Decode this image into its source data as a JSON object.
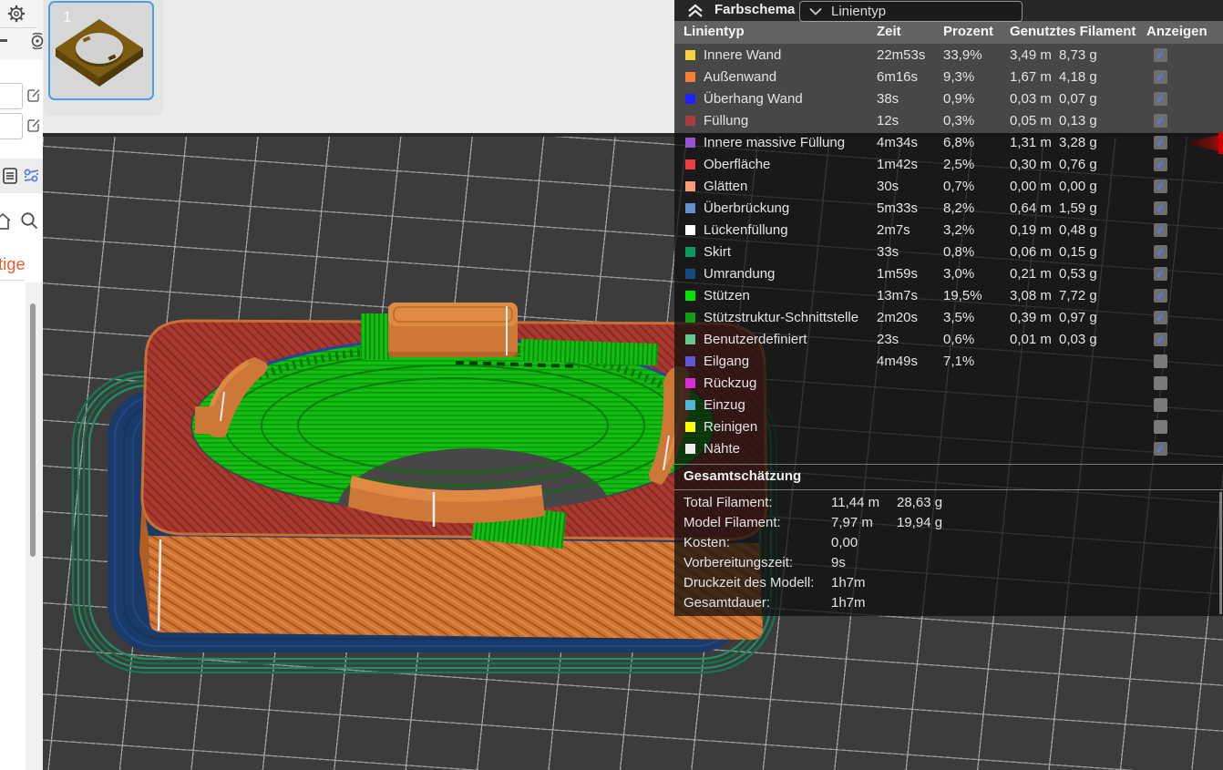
{
  "sidebar": {
    "icons": [
      "gear-icon",
      "minus-icon",
      "filament-spool-icon",
      "edit-icon",
      "edit-icon",
      "document-list-icon",
      "process-params-icon",
      "home-icon",
      "search-icon"
    ],
    "truncated_link_text": "tige"
  },
  "plates": {
    "selected_plate_number": "1"
  },
  "panel": {
    "title": "Farbschema",
    "view_dropdown": {
      "value": "Linientyp"
    },
    "table": {
      "columns": [
        "Linientyp",
        "Zeit",
        "Prozent",
        "Genutztes Filament",
        "Anzeigen"
      ],
      "rows": [
        {
          "color": "#F5D33C",
          "label": "Innere Wand",
          "time": "22m53s",
          "percent": "33,9%",
          "length": "3,49 m",
          "weight": "8,73 g",
          "visible": true
        },
        {
          "color": "#F77E35",
          "label": "Außenwand",
          "time": "6m16s",
          "percent": "9,3%",
          "length": "1,67 m",
          "weight": "4,18 g",
          "visible": true
        },
        {
          "color": "#2121FF",
          "label": "Überhang Wand",
          "time": "38s",
          "percent": "0,9%",
          "length": "0,03 m",
          "weight": "0,07 g",
          "visible": true
        },
        {
          "color": "#A93C3C",
          "label": "Füllung",
          "time": "12s",
          "percent": "0,3%",
          "length": "0,05 m",
          "weight": "0,13 g",
          "visible": true
        },
        {
          "color": "#9355D4",
          "label": "Innere massive Füllung",
          "time": "4m34s",
          "percent": "6,8%",
          "length": "1,31 m",
          "weight": "3,28 g",
          "visible": true
        },
        {
          "color": "#EB4040",
          "label": "Oberfläche",
          "time": "1m42s",
          "percent": "2,5%",
          "length": "0,30 m",
          "weight": "0,76 g",
          "visible": true
        },
        {
          "color": "#F89B77",
          "label": "Glätten",
          "time": "30s",
          "percent": "0,7%",
          "length": "0,00 m",
          "weight": "0,00 g",
          "visible": true
        },
        {
          "color": "#6190CE",
          "label": "Überbrückung",
          "time": "5m33s",
          "percent": "8,2%",
          "length": "0,64 m",
          "weight": "1,59 g",
          "visible": true
        },
        {
          "color": "#FFFFFF",
          "label": "Lückenfüllung",
          "time": "2m7s",
          "percent": "3,2%",
          "length": "0,19 m",
          "weight": "0,48 g",
          "visible": true
        },
        {
          "color": "#0B9A62",
          "label": "Skirt",
          "time": "33s",
          "percent": "0,8%",
          "length": "0,06 m",
          "weight": "0,15 g",
          "visible": true
        },
        {
          "color": "#144B80",
          "label": "Umrandung",
          "time": "1m59s",
          "percent": "3,0%",
          "length": "0,21 m",
          "weight": "0,53 g",
          "visible": true
        },
        {
          "color": "#06E206",
          "label": "Stützen",
          "time": "13m7s",
          "percent": "19,5%",
          "length": "3,08 m",
          "weight": "7,72 g",
          "visible": true
        },
        {
          "color": "#12A012",
          "label": "Stützstruktur-Schnittstelle",
          "time": "2m20s",
          "percent": "3,5%",
          "length": "0,39 m",
          "weight": "0,97 g",
          "visible": true
        },
        {
          "color": "#64C98D",
          "label": "Benutzerdefiniert",
          "time": "23s",
          "percent": "0,6%",
          "length": "0,01 m",
          "weight": "0,03 g",
          "visible": true
        },
        {
          "color": "#6058D6",
          "label": "Eilgang",
          "time": "4m49s",
          "percent": "7,1%",
          "length": "",
          "weight": "",
          "visible": false
        },
        {
          "color": "#DB2EDB",
          "label": "Rückzug",
          "time": "",
          "percent": "",
          "length": "",
          "weight": "",
          "visible": false
        },
        {
          "color": "#52B5D8",
          "label": "Einzug",
          "time": "",
          "percent": "",
          "length": "",
          "weight": "",
          "visible": false
        },
        {
          "color": "#FFFF00",
          "label": "Reinigen",
          "time": "",
          "percent": "",
          "length": "",
          "weight": "",
          "visible": false
        },
        {
          "color": "#EFECEC",
          "label": "Nähte",
          "time": "",
          "percent": "",
          "length": "",
          "weight": "",
          "visible": true
        }
      ]
    },
    "summary": {
      "title": "Gesamtschätzung",
      "rows": [
        {
          "label": "Total Filament:",
          "value": "11,44 m",
          "value2": "28,63 g"
        },
        {
          "label": "Model Filament:",
          "value": "7,97 m",
          "value2": "19,94 g"
        },
        {
          "label": "Kosten:",
          "value": "0,00",
          "value2": ""
        },
        {
          "label": "Vorbereitungszeit:",
          "value": "9s",
          "value2": ""
        },
        {
          "label": "Druckzeit des Modell:",
          "value": "1h7m",
          "value2": ""
        },
        {
          "label": "Gesamtdauer:",
          "value": "1h7m",
          "value2": ""
        }
      ]
    }
  },
  "viewport_colors": {
    "plate_background": "#3C3C3C",
    "grid_line": "#ACACAC",
    "top_surface_red": "#A83931",
    "outer_wall_orange": "#CF7434",
    "support_green": "#12BE12",
    "brim_navy": "#1A3A68",
    "skirt_teal": "#1A8A5E",
    "seam_white": "#EFEFEF",
    "checkbox_check_blue": "#4F82EA",
    "slider_handle_red": "#C40000"
  }
}
